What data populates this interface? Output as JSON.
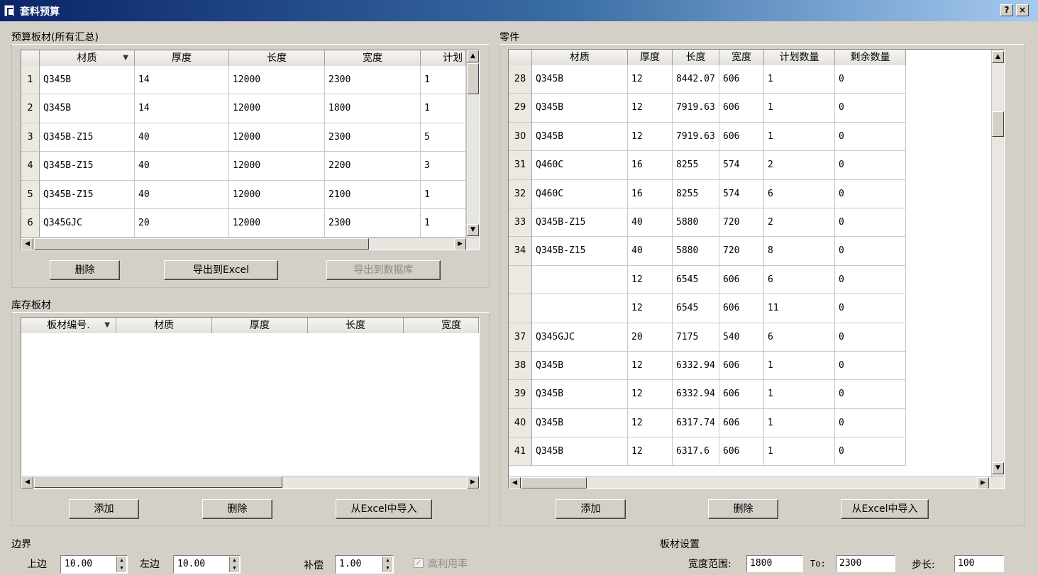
{
  "window": {
    "title": "套料预算",
    "help_label": "?",
    "close_label": "×"
  },
  "budget": {
    "label": "预算板材(所有汇总)",
    "columns": [
      "材质",
      "厚度",
      "长度",
      "宽度",
      "计划"
    ],
    "rows": [
      {
        "n": "1",
        "c": [
          "Q345B",
          "14",
          "12000",
          "2300",
          "1"
        ]
      },
      {
        "n": "2",
        "c": [
          "Q345B",
          "14",
          "12000",
          "1800",
          "1"
        ]
      },
      {
        "n": "3",
        "c": [
          "Q345B-Z15",
          "40",
          "12000",
          "2300",
          "5"
        ]
      },
      {
        "n": "4",
        "c": [
          "Q345B-Z15",
          "40",
          "12000",
          "2200",
          "3"
        ]
      },
      {
        "n": "5",
        "c": [
          "Q345B-Z15",
          "40",
          "12000",
          "2100",
          "1"
        ]
      },
      {
        "n": "6",
        "c": [
          "Q345GJC",
          "20",
          "12000",
          "2300",
          "1"
        ]
      }
    ],
    "buttons": {
      "delete": "删除",
      "export_excel": "导出到Excel",
      "export_db": "导出到数据库"
    }
  },
  "stock": {
    "label": "库存板材",
    "columns": [
      "板材编号.",
      "材质",
      "厚度",
      "长度",
      "宽度"
    ],
    "buttons": {
      "add": "添加",
      "delete": "删除",
      "import": "从Excel中导入"
    }
  },
  "parts": {
    "label": "零件",
    "columns": [
      "材质",
      "厚度",
      "长度",
      "宽度",
      "计划数量",
      "剩余数量"
    ],
    "rows": [
      {
        "n": "28",
        "c": [
          "Q345B",
          "12",
          "8442.07",
          "606",
          "1",
          "0"
        ]
      },
      {
        "n": "29",
        "c": [
          "Q345B",
          "12",
          "7919.63",
          "606",
          "1",
          "0"
        ]
      },
      {
        "n": "30",
        "c": [
          "Q345B",
          "12",
          "7919.63",
          "606",
          "1",
          "0"
        ]
      },
      {
        "n": "31",
        "c": [
          "Q460C",
          "16",
          "8255",
          "574",
          "2",
          "0"
        ]
      },
      {
        "n": "32",
        "c": [
          "Q460C",
          "16",
          "8255",
          "574",
          "6",
          "0"
        ]
      },
      {
        "n": "33",
        "c": [
          "Q345B-Z15",
          "40",
          "5880",
          "720",
          "2",
          "0"
        ]
      },
      {
        "n": "34",
        "c": [
          "Q345B-Z15",
          "40",
          "5880",
          "720",
          "8",
          "0"
        ]
      },
      {
        "n": "",
        "c": [
          "",
          "12",
          "6545",
          "606",
          "6",
          "0"
        ]
      },
      {
        "n": "",
        "c": [
          "",
          "12",
          "6545",
          "606",
          "11",
          "0"
        ]
      },
      {
        "n": "37",
        "c": [
          "Q345GJC",
          "20",
          "7175",
          "540",
          "6",
          "0"
        ]
      },
      {
        "n": "38",
        "c": [
          "Q345B",
          "12",
          "6332.94",
          "606",
          "1",
          "0"
        ]
      },
      {
        "n": "39",
        "c": [
          "Q345B",
          "12",
          "6332.94",
          "606",
          "1",
          "0"
        ]
      },
      {
        "n": "40",
        "c": [
          "Q345B",
          "12",
          "6317.74",
          "606",
          "1",
          "0"
        ]
      },
      {
        "n": "41",
        "c": [
          "Q345B",
          "12",
          "6317.6",
          "606",
          "1",
          "0"
        ]
      }
    ],
    "buttons": {
      "add": "添加",
      "delete": "删除",
      "import": "从Excel中导入"
    }
  },
  "border": {
    "label": "边界",
    "top_label": "上边",
    "top_value": "10.00",
    "left_label": "左边",
    "left_value": "10.00",
    "comp_label": "补偿",
    "comp_value": "1.00",
    "high_util_label": "高利用率",
    "high_util_checked": true
  },
  "plate": {
    "label": "板材设置",
    "width_range_label": "宽度范围:",
    "width_from": "1800",
    "to_label": "To:",
    "width_to": "2300",
    "step_label": "步长:",
    "step_value": "100"
  }
}
